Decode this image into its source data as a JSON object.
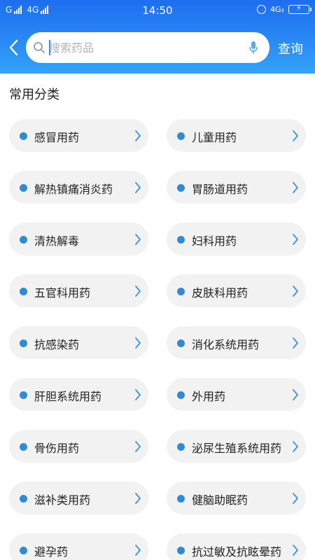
{
  "status": {
    "carrier1": "G",
    "carrier2": "4G",
    "time": "14:50",
    "network_right": "4G₂"
  },
  "header": {
    "search_placeholder": "搜索药品",
    "query_label": "查询"
  },
  "section": {
    "title": "常用分类"
  },
  "categories": [
    {
      "label": "感冒用药"
    },
    {
      "label": "儿童用药"
    },
    {
      "label": "解热镇痛消炎药"
    },
    {
      "label": "胃肠道用药"
    },
    {
      "label": "清热解毒"
    },
    {
      "label": "妇科用药"
    },
    {
      "label": "五官科用药"
    },
    {
      "label": "皮肤科用药"
    },
    {
      "label": "抗感染药"
    },
    {
      "label": "消化系统用药"
    },
    {
      "label": "肝胆系统用药"
    },
    {
      "label": "外用药"
    },
    {
      "label": "骨伤用药"
    },
    {
      "label": "泌尿生殖系统用药"
    },
    {
      "label": "滋补类用药"
    },
    {
      "label": "健脑助眠药"
    },
    {
      "label": "避孕药"
    },
    {
      "label": "抗过敏及抗眩晕药"
    }
  ],
  "colors": {
    "accent": "#2a8cf6",
    "dot": "#2e8bd6",
    "chip_bg": "#f2f2f2"
  },
  "icons": {
    "back": "back-arrow-icon",
    "search": "search-icon",
    "mic": "microphone-icon",
    "chevron": "chevron-right-icon"
  }
}
